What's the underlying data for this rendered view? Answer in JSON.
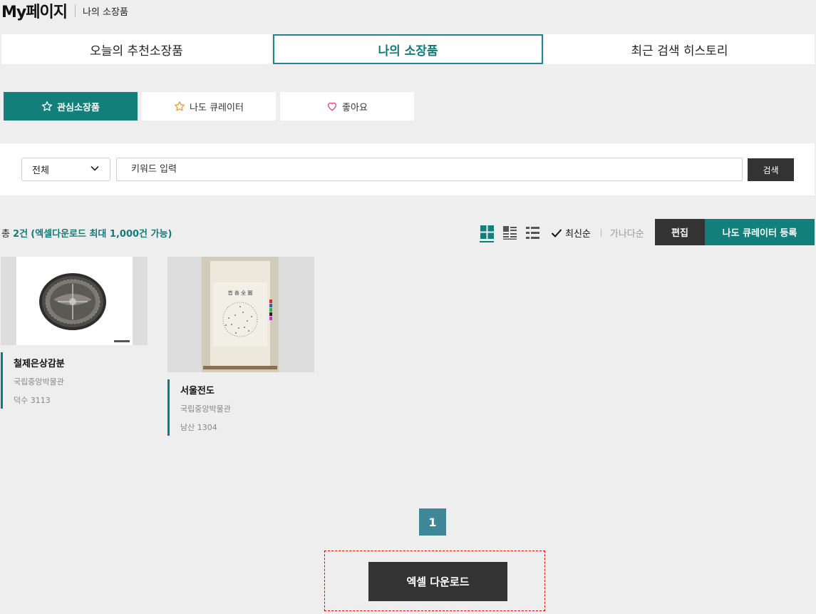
{
  "header": {
    "title": "My페이지",
    "crumb": "나의 소장품"
  },
  "main_tabs": [
    {
      "label": "오늘의 추천소장품"
    },
    {
      "label": "나의 소장품"
    },
    {
      "label": "최근 검색 히스토리"
    }
  ],
  "sub_tabs": [
    {
      "label": "관심소장품",
      "icon": "star-icon"
    },
    {
      "label": "나도 큐레이터",
      "icon": "star-icon"
    },
    {
      "label": "좋아요",
      "icon": "heart-icon"
    }
  ],
  "search": {
    "select_value": "전체",
    "placeholder": "키워드 입력",
    "button": "검색"
  },
  "results": {
    "prefix": "총 ",
    "count": "2건",
    "note": "(엑셀다운로드 최대 1,000건 가능)",
    "sort_active": "최신순",
    "sort_other": "가나다순",
    "edit_label": "편집",
    "register_label": "나도 큐레이터 등록"
  },
  "items": [
    {
      "name": "철제은상감분",
      "museum": "국립중앙박물관",
      "number": "덕수 3113"
    },
    {
      "name": "서울전도",
      "museum": "국립중앙박물관",
      "number": "남산 1304"
    }
  ],
  "pagination": {
    "current": "1"
  },
  "excel": {
    "label": "엑셀 다운로드"
  },
  "colors": {
    "accent": "#127f7a",
    "dark": "#333333",
    "pager": "#3e8796",
    "heart": "#e5457a",
    "star_outline": "#e8a23a"
  }
}
